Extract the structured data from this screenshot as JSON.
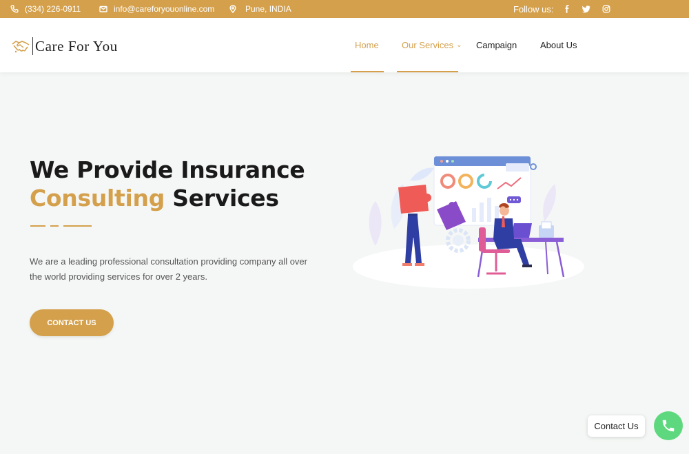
{
  "topbar": {
    "phone": "(334) 226-0911",
    "email": "info@careforyouonline.com",
    "location": "Pune, INDIA",
    "follow_label": "Follow us:",
    "social_icons": [
      "facebook-icon",
      "twitter-icon",
      "instagram-icon"
    ]
  },
  "header": {
    "logo_text": "Care For You",
    "nav": [
      {
        "label": "Home",
        "active": true
      },
      {
        "label": "Our Services",
        "active": true,
        "has_dropdown": true
      },
      {
        "label": "Campaign",
        "active": false
      },
      {
        "label": "About Us",
        "active": false
      }
    ]
  },
  "hero": {
    "title_line1": "We Provide Insurance",
    "title_accent": "Consulting",
    "title_rest": " Services",
    "description": "We are a leading professional consultation providing company all over the world providing services for over 2 years.",
    "cta_label": "CONTACT US"
  },
  "floating": {
    "label": "Contact Us",
    "icon": "phone-icon"
  },
  "colors": {
    "accent": "#d4a04c",
    "background": "#f5f7f6",
    "call_button": "#5ed87f"
  }
}
